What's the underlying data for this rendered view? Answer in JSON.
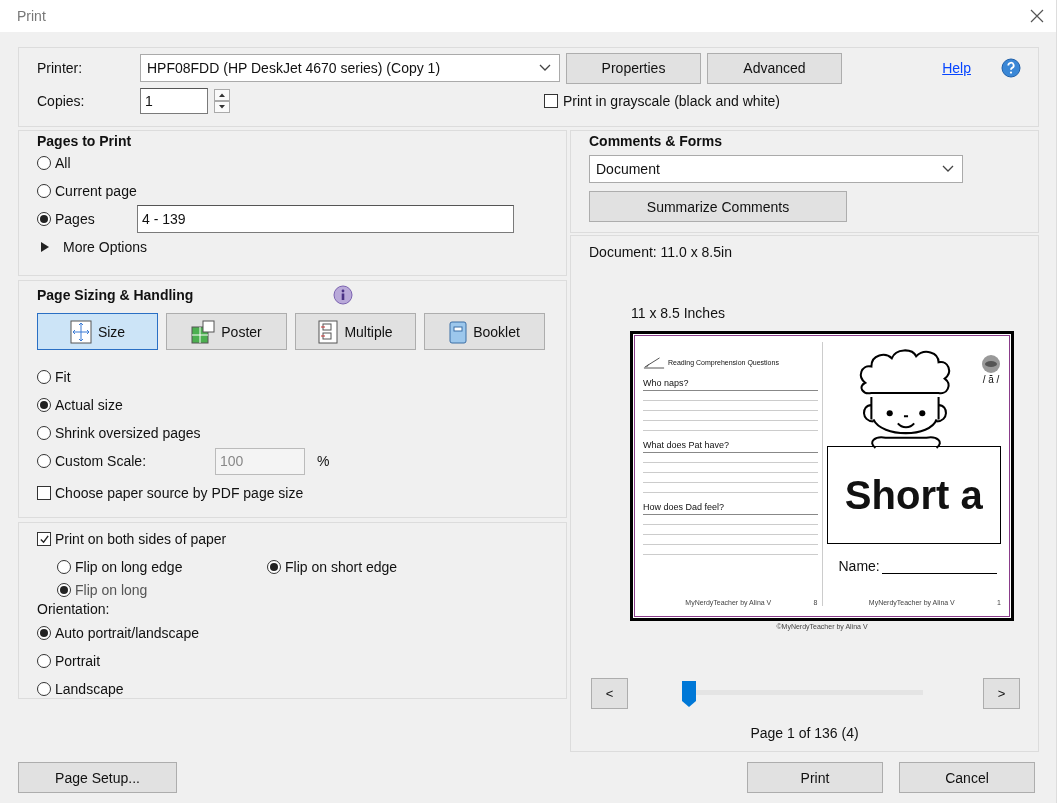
{
  "window": {
    "title": "Print"
  },
  "printer": {
    "label": "Printer:",
    "value": "HPF08FDD (HP DeskJet 4670 series) (Copy 1)",
    "buttons": [
      "Properties",
      "Advanced"
    ],
    "help": "Help"
  },
  "copies": {
    "label": "Copies:",
    "value": "1"
  },
  "grayscale": {
    "label": "Print in grayscale (black and white)",
    "checked": false
  },
  "pages_to_print": {
    "title": "Pages to Print",
    "options": [
      {
        "label": "All",
        "selected": false
      },
      {
        "label": "Current page",
        "selected": false
      },
      {
        "label": "Pages",
        "selected": true,
        "value": "4 - 139"
      }
    ],
    "more_options": {
      "label": "More Options",
      "expanded": false
    }
  },
  "page_sizing": {
    "title": "Page Sizing & Handling",
    "modes": [
      {
        "label": "Size",
        "kind": "size",
        "selected": true
      },
      {
        "label": "Poster",
        "kind": "poster",
        "selected": false
      },
      {
        "label": "Multiple",
        "kind": "multiple",
        "selected": false
      },
      {
        "label": "Booklet",
        "kind": "booklet",
        "selected": false
      }
    ],
    "options": [
      {
        "label": "Fit",
        "selected": false
      },
      {
        "label": "Actual size",
        "selected": true
      },
      {
        "label": "Shrink oversized pages",
        "selected": false
      },
      {
        "label": "Custom Scale:",
        "selected": false,
        "value": "100",
        "unit": "%"
      }
    ],
    "paper_source": {
      "label": "Choose paper source by PDF page size",
      "checked": false
    }
  },
  "duplex": {
    "label": "Print on both sides of paper",
    "checked": true,
    "options": [
      {
        "label": "Flip on long edge",
        "selected": false
      },
      {
        "label": "Flip on short edge",
        "selected": true
      }
    ],
    "ghost_option": {
      "label": "Flip on long",
      "selected": true
    }
  },
  "orientation": {
    "title": "Orientation:",
    "options": [
      {
        "label": "Auto portrait/landscape",
        "selected": true
      },
      {
        "label": "Portrait",
        "selected": false
      },
      {
        "label": "Landscape",
        "selected": false
      }
    ]
  },
  "comments_forms": {
    "title": "Comments & Forms",
    "value": "Document",
    "button": "Summarize Comments"
  },
  "preview": {
    "document_size": "Document: 11.0 x 8.5in",
    "page_size": "11 x 8.5 Inches",
    "left_page": {
      "header": "Reading Comprehension Questions",
      "questions": [
        "Who naps?",
        "What does Pat have?",
        "How does Dad feel?"
      ],
      "footer": "MyNerdyTeacher by Alina V",
      "number": "8"
    },
    "right_page": {
      "sound": "/ ă /",
      "title": "Short a",
      "name_label": "Name:",
      "footer": "MyNerdyTeacher by Alina V",
      "number": "1"
    },
    "credit": "©MyNerdyTeacher by Alina V",
    "prev": "<",
    "next": ">",
    "slider": {
      "level": 0
    },
    "status": "Page 1 of 136 (4)"
  },
  "footer": {
    "page_setup": "Page Setup...",
    "buttons": [
      "Print",
      "Cancel"
    ]
  }
}
